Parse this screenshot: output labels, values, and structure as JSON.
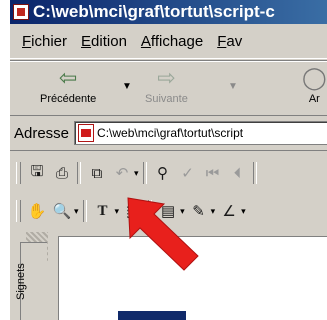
{
  "window": {
    "title": "C:\\web\\mci\\graf\\tortut\\script-c"
  },
  "menu": {
    "items": [
      {
        "key": "F",
        "rest": "ichier"
      },
      {
        "key": "E",
        "rest": "dition"
      },
      {
        "key": "A",
        "rest": "ffichage"
      },
      {
        "key": "F",
        "rest": "av"
      }
    ]
  },
  "nav": {
    "back_label": "Précédente",
    "forward_label": "Suivante",
    "next_label": "Ar"
  },
  "address": {
    "label": "Adresse",
    "value": "C:\\web\\mci\\graf\\tortut\\script"
  },
  "toolbar1": {
    "icons": [
      "save-icon",
      "print-icon",
      "copy-icon",
      "undo-icon",
      "find-icon",
      "spellcheck-icon",
      "first-page-icon",
      "prev-page-icon"
    ]
  },
  "toolbar2": {
    "icons": [
      "hand-tool-icon",
      "zoom-icon",
      "text-select-icon",
      "column-select-icon",
      "note-icon",
      "pencil-icon",
      "line-icon"
    ]
  },
  "side_panel": {
    "tab_label": "Signets"
  },
  "colors": {
    "pointer_arrow": "#e8201c",
    "titlebar": "#0a246a"
  }
}
